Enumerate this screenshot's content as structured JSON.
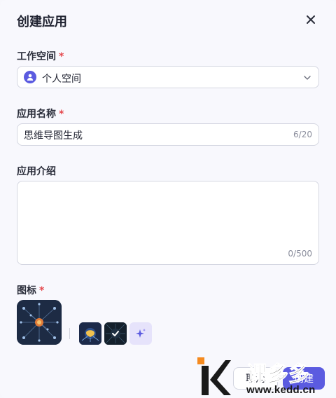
{
  "dialog": {
    "title": "创建应用",
    "close_icon": "close-icon"
  },
  "workspace": {
    "label": "工作空间",
    "required": "*",
    "value": "个人空间",
    "icon": "user-avatar-icon"
  },
  "app_name": {
    "label": "应用名称",
    "required": "*",
    "value": "思维导图生成",
    "counter": "6/20"
  },
  "app_intro": {
    "label": "应用介绍",
    "value": "",
    "counter": "0/500"
  },
  "icon_section": {
    "label": "图标",
    "required": "*",
    "options": [
      "selected-graph-icon",
      "brain-circuit-icon",
      "check-network-icon",
      "ai-sparkle-icon"
    ]
  },
  "footer": {
    "cancel_label": "取消",
    "create_label": "创建"
  },
  "watermark": {
    "text": "课多多",
    "url": "www.kedd.cn"
  },
  "colors": {
    "accent": "#5b5be0",
    "required": "#e5484d",
    "border": "#d4d6e1"
  }
}
